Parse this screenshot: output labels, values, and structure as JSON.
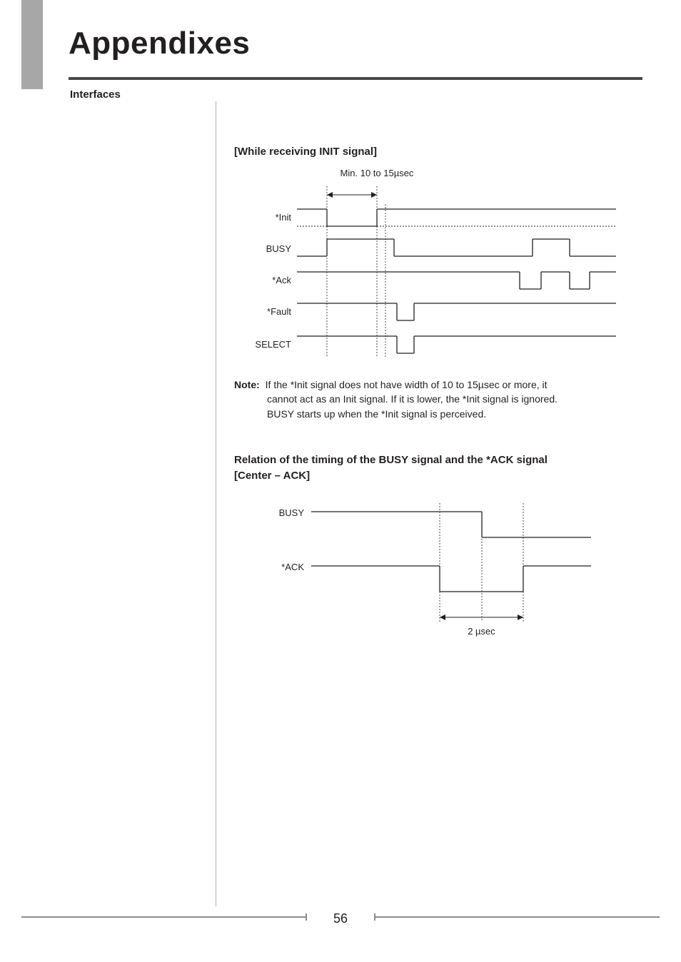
{
  "title": "Appendixes",
  "section": "Interfaces",
  "diagram1": {
    "heading": "[While receiving INIT signal]",
    "topLabel": "Min. 10 to 15µsec",
    "signals": [
      "*Init",
      "BUSY",
      "*Ack",
      "*Fault",
      "SELECT"
    ]
  },
  "note": {
    "label": "Note:",
    "line1": "If the *Init signal does not have width of 10 to 15µsec or more, it",
    "line2": "cannot act as an Init signal. If it is lower, the *Init signal is ignored.",
    "line3": "BUSY starts up when the *Init signal is perceived."
  },
  "diagram2": {
    "headingLine1": "Relation of the timing of the BUSY signal and the *ACK signal",
    "headingLine2": "[Center – ACK]",
    "signals": [
      "BUSY",
      "*ACK"
    ],
    "bottomLabel": "2 µsec"
  },
  "pageNumber": "56",
  "chart_data": [
    {
      "type": "timing-diagram",
      "title": "[While receiving INIT signal]",
      "annotation": "Min. 10 to 15µsec (width of *Init low pulse)",
      "time_markers": {
        "t0_init_fall": 0,
        "t1_init_rise": 12,
        "t2_busy_rise_after_init": 14
      },
      "signals": [
        {
          "name": "*Init",
          "transitions": [
            "high",
            "falling@t0",
            "low(10-15µsec)",
            "rising@t1",
            "undefined-dotted",
            "high"
          ]
        },
        {
          "name": "BUSY",
          "transitions": [
            "low",
            "rising@t0",
            "high",
            "falling@t2+short",
            "low",
            "later-pulse-high",
            "low"
          ]
        },
        {
          "name": "*Ack",
          "transitions": [
            "high",
            "late-low-pulse",
            "high",
            "second-low-pulse",
            "high"
          ]
        },
        {
          "name": "*Fault",
          "transitions": [
            "high",
            "brief-low-pulse-after-t2",
            "high"
          ]
        },
        {
          "name": "SELECT",
          "transitions": [
            "high",
            "brief-low-pulse-after-t2",
            "high"
          ]
        }
      ]
    },
    {
      "type": "timing-diagram",
      "title": "Relation of the timing of the BUSY signal and the *ACK signal [Center – ACK]",
      "annotation": "2 µsec (width of *ACK low pulse)",
      "signals": [
        {
          "name": "BUSY",
          "transitions": [
            "high",
            "falling@center-of-ack-pulse",
            "low"
          ]
        },
        {
          "name": "*ACK",
          "transitions": [
            "high",
            "falling@start",
            "low(2µsec)",
            "rising@end",
            "high"
          ]
        }
      ],
      "relation": "BUSY falling edge occurs at the center of the *ACK low pulse"
    }
  ]
}
